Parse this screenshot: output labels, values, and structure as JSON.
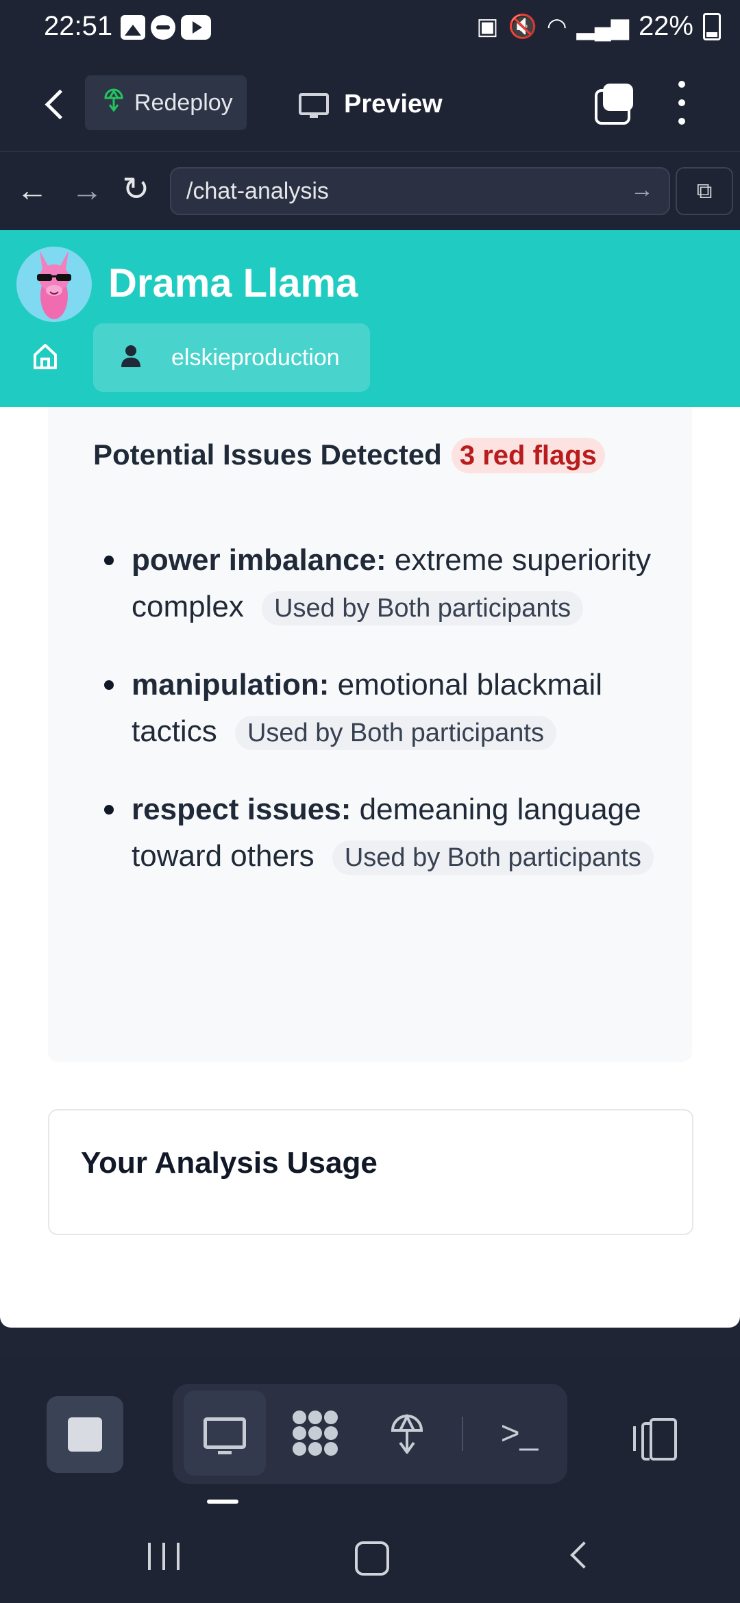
{
  "status_bar": {
    "time": "22:51",
    "battery": "22%"
  },
  "toolbar": {
    "redeploy_label": "Redeploy",
    "preview_label": "Preview"
  },
  "browser": {
    "url": "/chat-analysis"
  },
  "app": {
    "brand": "Drama Llama",
    "user_label": "elskieproduction",
    "accent_color": "#20cbc1"
  },
  "issues": {
    "title": "Potential Issues Detected",
    "badge": "3 red flags",
    "items": [
      {
        "key": "power imbalance:",
        "text": "extreme superiority complex",
        "tag": "Used by Both participants"
      },
      {
        "key": "manipulation:",
        "text": "emotional blackmail tactics",
        "tag": "Used by Both participants"
      },
      {
        "key": "respect issues:",
        "text": "demeaning language toward others",
        "tag": "Used by Both participants"
      }
    ]
  },
  "usage": {
    "title": "Your Analysis Usage"
  },
  "icons": {
    "back": "chevron-left-icon",
    "redeploy": "deploy-icon",
    "preview": "monitor-icon",
    "tabs": "tabs-icon",
    "more": "more-vertical-icon",
    "home": "home-icon",
    "user": "user-icon"
  }
}
